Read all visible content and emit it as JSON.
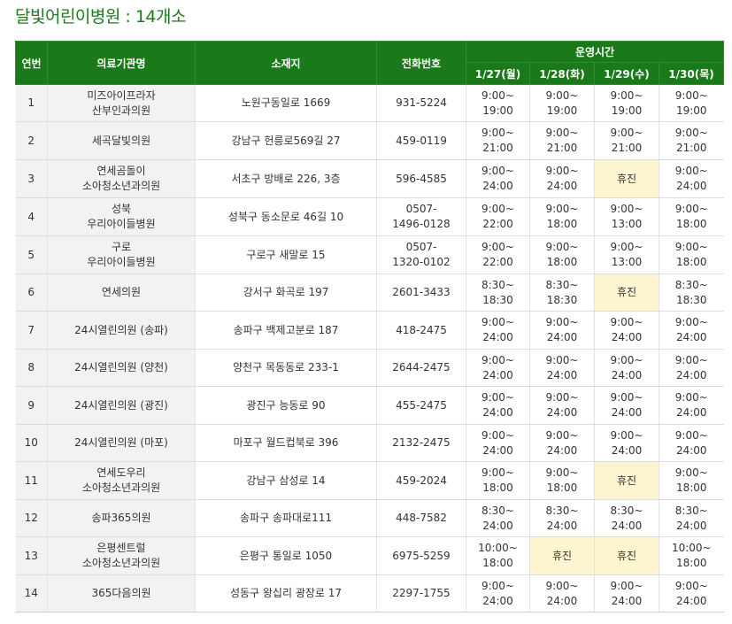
{
  "title": "달빛어린이병원 : 14개소",
  "headers": {
    "no": "연번",
    "name": "의료기관명",
    "address": "소재지",
    "phone": "전화번호",
    "hours": "운영시간",
    "days": [
      "1/27(월)",
      "1/28(화)",
      "1/29(수)",
      "1/30(목)"
    ]
  },
  "rows": [
    {
      "no": "1",
      "name": "미즈아이프라자\n산부인과의원",
      "address": "노원구동일로 1669",
      "phone": "931-5224",
      "hours": [
        "9:00~\n19:00",
        "9:00~\n19:00",
        "9:00~\n19:00",
        "9:00~\n19:00"
      ]
    },
    {
      "no": "2",
      "name": "세곡달빛의원",
      "address": "강남구 헌릉로569길 27",
      "phone": "459-0119",
      "hours": [
        "9:00~\n21:00",
        "9:00~\n21:00",
        "9:00~\n21:00",
        "9:00~\n21:00"
      ]
    },
    {
      "no": "3",
      "name": "연세곰돌이\n소아청소년과의원",
      "address": "서초구 방배로 226, 3층",
      "phone": "596-4585",
      "hours": [
        "9:00~\n24:00",
        "9:00~\n24:00",
        "휴진",
        "9:00~\n24:00"
      ]
    },
    {
      "no": "4",
      "name": "성북\n우리아이들병원",
      "address": "성북구 동소문로 46길 10",
      "phone": "0507-\n1496-0128",
      "hours": [
        "9:00~\n22:00",
        "9:00~\n18:00",
        "9:00~\n13:00",
        "9:00~\n18:00"
      ]
    },
    {
      "no": "5",
      "name": "구로\n우리아이들병원",
      "address": "구로구 새말로 15",
      "phone": "0507-\n1320-0102",
      "hours": [
        "9:00~\n22:00",
        "9:00~\n18:00",
        "9:00~\n13:00",
        "9:00~\n18:00"
      ]
    },
    {
      "no": "6",
      "name": "연세의원",
      "address": "강서구 화곡로 197",
      "phone": "2601-3433",
      "hours": [
        "8:30~\n18:30",
        "8:30~\n18:30",
        "휴진",
        "8:30~\n18:30"
      ]
    },
    {
      "no": "7",
      "name": "24시열린의원 (송파)",
      "address": "송파구 백제고분로 187",
      "phone": "418-2475",
      "hours": [
        "9:00~\n24:00",
        "9:00~\n24:00",
        "9:00~\n24:00",
        "9:00~\n24:00"
      ]
    },
    {
      "no": "8",
      "name": "24시열린의원 (양천)",
      "address": "양천구 목동동로 233-1",
      "phone": "2644-2475",
      "hours": [
        "9:00~\n24:00",
        "9:00~\n24:00",
        "9:00~\n24:00",
        "9:00~\n24:00"
      ]
    },
    {
      "no": "9",
      "name": "24시열린의원 (광진)",
      "address": "광진구 능동로 90",
      "phone": "455-2475",
      "hours": [
        "9:00~\n24:00",
        "9:00~\n24:00",
        "9:00~\n24:00",
        "9:00~\n24:00"
      ]
    },
    {
      "no": "10",
      "name": "24시열린의원 (마포)",
      "address": "마포구 월드컵북로 396",
      "phone": "2132-2475",
      "hours": [
        "9:00~\n24:00",
        "9:00~\n24:00",
        "9:00~\n24:00",
        "9:00~\n24:00"
      ]
    },
    {
      "no": "11",
      "name": "연세도우리\n소아청소년과의원",
      "address": "강남구 삼성로 14",
      "phone": "459-2024",
      "hours": [
        "9:00~\n18:00",
        "9:00~\n18:00",
        "휴진",
        "9:00~\n18:00"
      ]
    },
    {
      "no": "12",
      "name": "송파365의원",
      "address": "송파구 송파대로111",
      "phone": "448-7582",
      "hours": [
        "8:30~\n24:00",
        "8:30~\n24:00",
        "8:30~\n24:00",
        "8:30~\n24:00"
      ]
    },
    {
      "no": "13",
      "name": "은평센트럴\n소아청소년과의원",
      "address": "은평구 통일로 1050",
      "phone": "6975-5259",
      "hours": [
        "10:00~\n18:00",
        "휴진",
        "휴진",
        "10:00~\n18:00"
      ]
    },
    {
      "no": "14",
      "name": "365다음의원",
      "address": "성동구 왕십리 광장로 17",
      "phone": "2297-1755",
      "hours": [
        "9:00~\n24:00",
        "9:00~\n24:00",
        "9:00~\n24:00",
        "9:00~\n24:00"
      ]
    }
  ],
  "colors": {
    "header_bg": "#1a7a1a",
    "title": "#1d7a1d",
    "closed_bg": "#fdf5cf",
    "label_col_bg": "#f2f2f2"
  }
}
